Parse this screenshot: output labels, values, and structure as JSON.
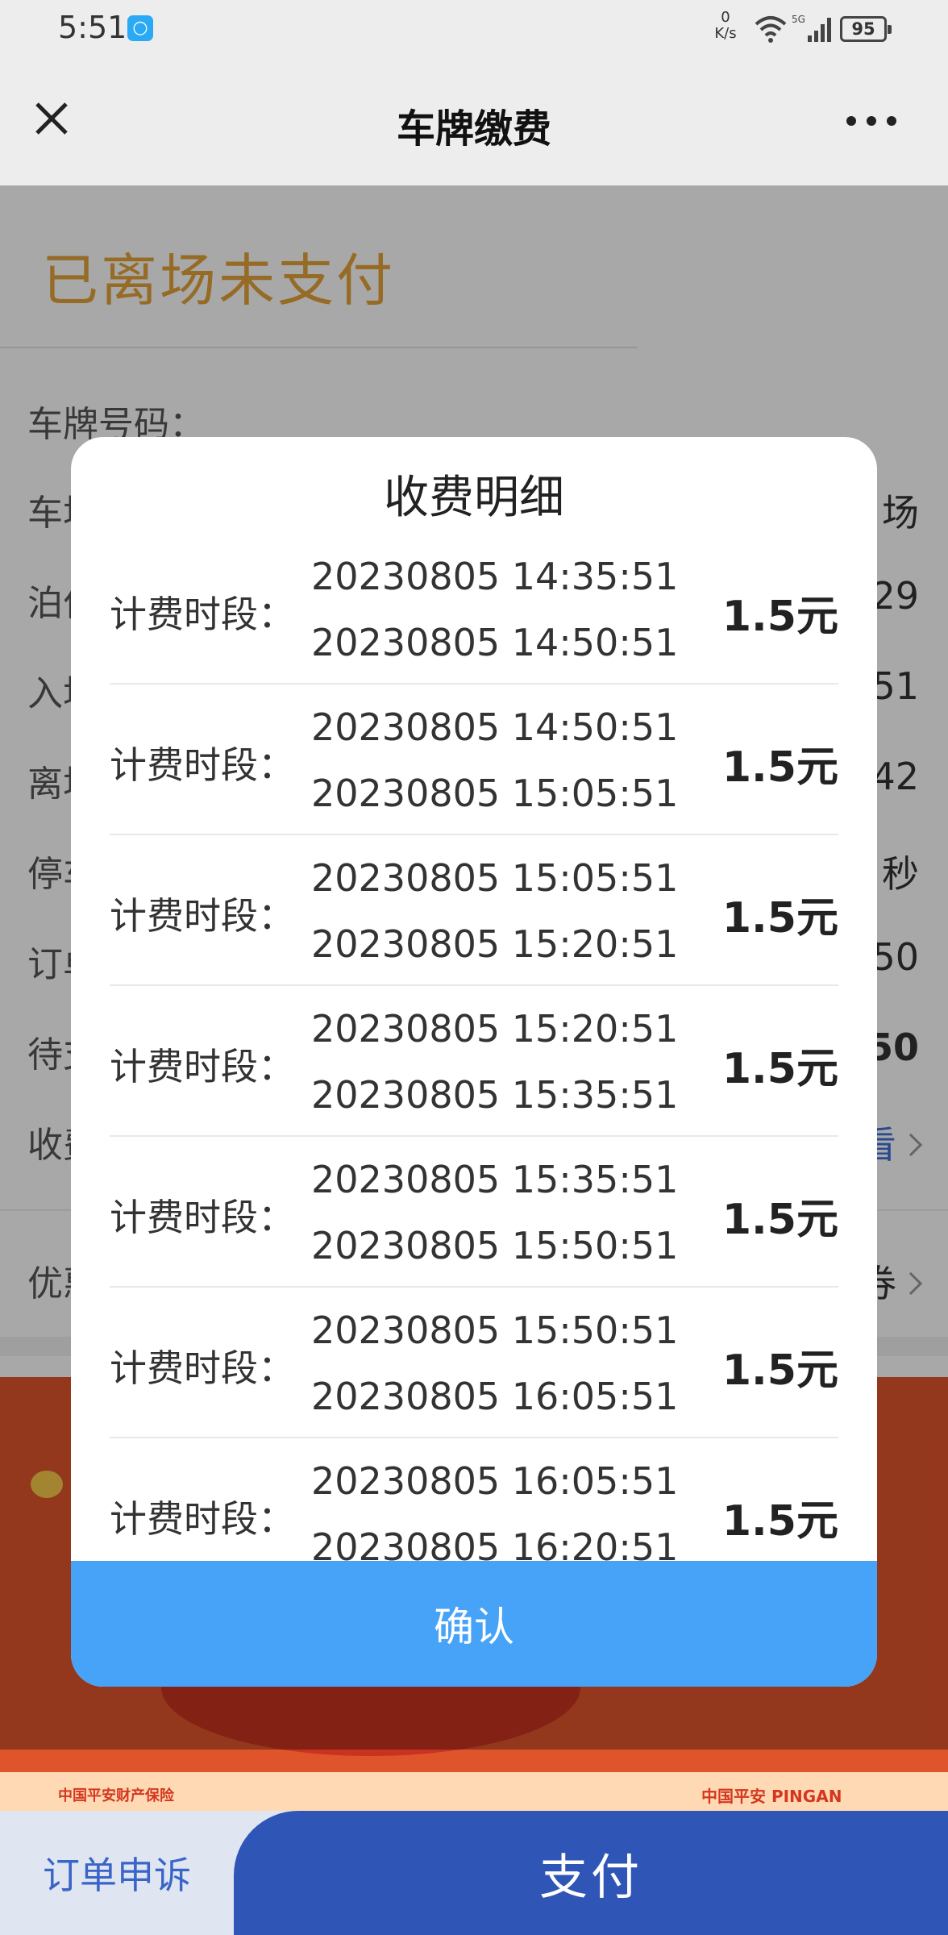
{
  "status_bar": {
    "time": "5:51",
    "net_speed_value": "0",
    "net_speed_unit": "K/s",
    "network_type": "5G",
    "battery": "95"
  },
  "nav": {
    "title": "车牌缴费"
  },
  "page": {
    "status_title": "已离场未支付",
    "rows": [
      {
        "label": "车牌号码："
      },
      {
        "label": "车场",
        "value": "场"
      },
      {
        "label": "泊位",
        "value": "29"
      },
      {
        "label": "入场",
        "value": "51"
      },
      {
        "label": "离场",
        "value": "42"
      },
      {
        "label": "停车",
        "value": "秒"
      },
      {
        "label": "订单",
        "value": "50"
      },
      {
        "label": "待支",
        "value": "50"
      },
      {
        "label": "收费",
        "value": "看"
      },
      {
        "label": "优惠",
        "value": "券"
      }
    ]
  },
  "banner": {
    "logo_left": "中国平安财产保险",
    "logo_right": "中国平安 PINGAN"
  },
  "bottom": {
    "appeal_label": "订单申诉",
    "pay_label": "支付"
  },
  "modal": {
    "title": "收费明细",
    "fee_label": "计费时段：",
    "items": [
      {
        "start": "20230805 14:35:51",
        "end": "20230805 14:50:51",
        "amount": "1.5元"
      },
      {
        "start": "20230805 14:50:51",
        "end": "20230805 15:05:51",
        "amount": "1.5元"
      },
      {
        "start": "20230805 15:05:51",
        "end": "20230805 15:20:51",
        "amount": "1.5元"
      },
      {
        "start": "20230805 15:20:51",
        "end": "20230805 15:35:51",
        "amount": "1.5元"
      },
      {
        "start": "20230805 15:35:51",
        "end": "20230805 15:50:51",
        "amount": "1.5元"
      },
      {
        "start": "20230805 15:50:51",
        "end": "20230805 16:05:51",
        "amount": "1.5元"
      },
      {
        "start": "20230805 16:05:51",
        "end": "20230805 16:20:51",
        "amount": "1.5元"
      }
    ],
    "confirm_label": "确认"
  }
}
